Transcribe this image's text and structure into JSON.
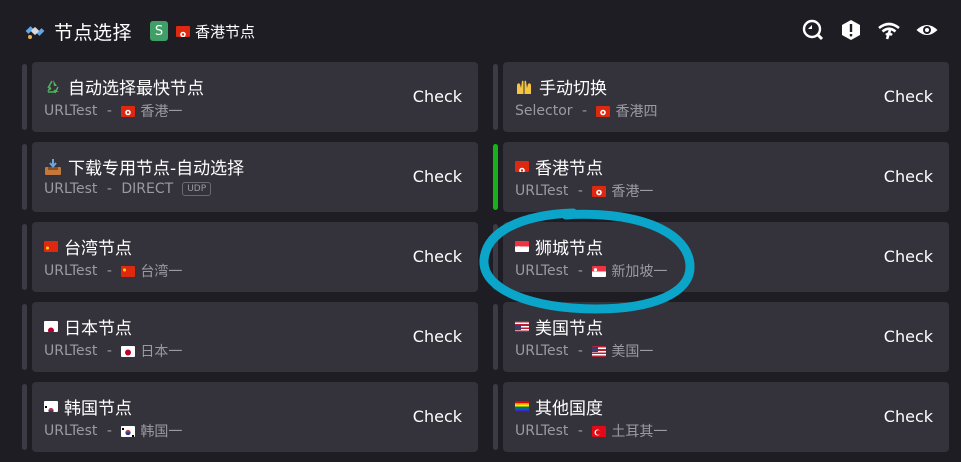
{
  "header": {
    "title": "节点选择",
    "badge": "S",
    "current_node": "香港节点",
    "current_flag": "hk",
    "icons": [
      "latency-test-icon",
      "alert-icon",
      "wifi-icon",
      "visibility-icon"
    ]
  },
  "left_groups": [
    {
      "name": "自动选择最快节点",
      "icon": "recycle-icon",
      "type": "URLTest",
      "current": "香港一",
      "flag": "hk",
      "action": "Check",
      "active": false
    },
    {
      "name": "下载专用节点-自动选择",
      "icon": "inbox-tray-icon",
      "type": "URLTest",
      "current": "DIRECT",
      "flag": "",
      "udp": "UDP",
      "action": "Check",
      "active": false
    },
    {
      "name": "台湾节点",
      "icon": "",
      "type": "URLTest",
      "current": "台湾一",
      "flag": "cn",
      "name_flag": "cn",
      "action": "Check",
      "active": false
    },
    {
      "name": "日本节点",
      "icon": "",
      "type": "URLTest",
      "current": "日本一",
      "flag": "jp",
      "name_flag": "jp",
      "action": "Check",
      "active": false
    },
    {
      "name": "韩国节点",
      "icon": "",
      "type": "URLTest",
      "current": "韩国一",
      "flag": "kr",
      "name_flag": "kr",
      "action": "Check",
      "active": false
    }
  ],
  "right_groups": [
    {
      "name": "手动切换",
      "icon": "raising-hands-icon",
      "type": "Selector",
      "current": "香港四",
      "flag": "hk",
      "action": "Check",
      "active": false
    },
    {
      "name": "香港节点",
      "icon": "",
      "type": "URLTest",
      "current": "香港一",
      "flag": "hk",
      "name_flag": "hk",
      "action": "Check",
      "active": true
    },
    {
      "name": "狮城节点",
      "icon": "",
      "type": "URLTest",
      "current": "新加坡一",
      "flag": "sg",
      "name_flag": "sg",
      "action": "Check",
      "active": false
    },
    {
      "name": "美国节点",
      "icon": "",
      "type": "URLTest",
      "current": "美国一",
      "flag": "us",
      "name_flag": "us",
      "action": "Check",
      "active": false
    },
    {
      "name": "其他国度",
      "icon": "",
      "type": "URLTest",
      "current": "土耳其一",
      "flag": "tr",
      "name_flag": "rainbow",
      "action": "Check",
      "active": false
    }
  ],
  "separator": " - ",
  "colors": {
    "background": "#1e1d24",
    "card": "#34333c",
    "active_bar": "#17b21a",
    "inactive_bar": "#3b3a45",
    "annotation": "#0aa5c9"
  }
}
